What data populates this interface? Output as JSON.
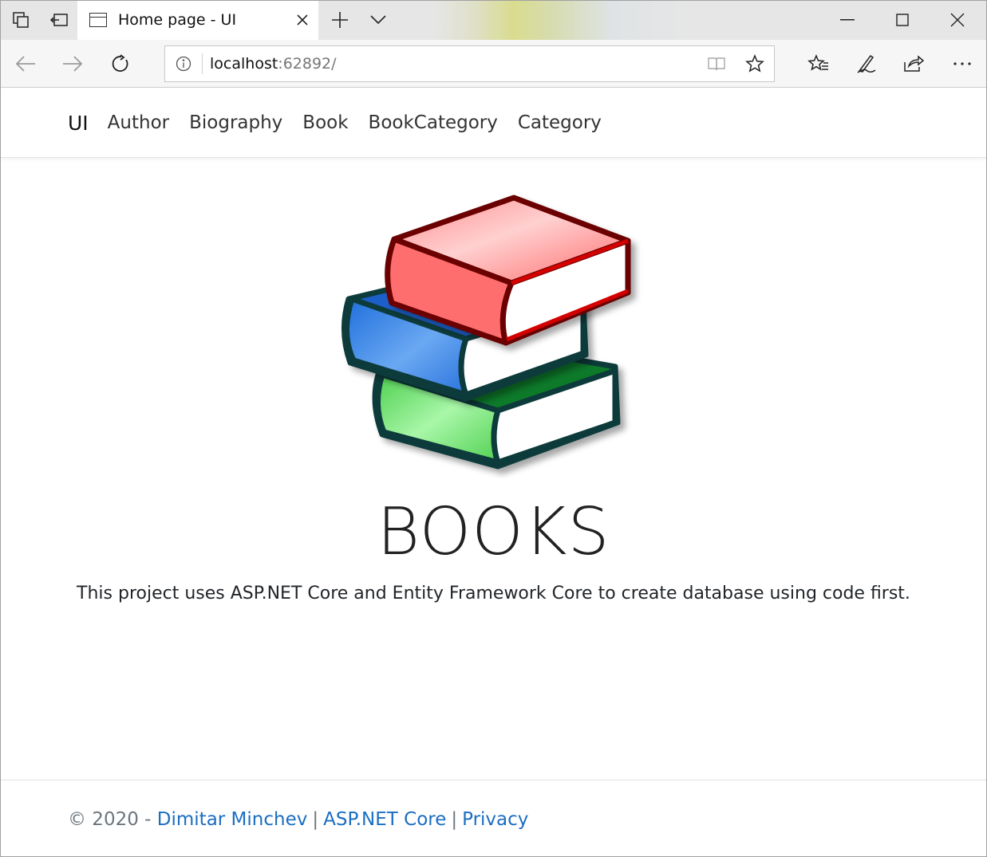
{
  "browser": {
    "tab_title": "Home page - UI",
    "address": {
      "host": "localhost",
      "port_path": ":62892/"
    }
  },
  "site": {
    "brand": "UI",
    "nav": [
      {
        "label": "Author"
      },
      {
        "label": "Biography"
      },
      {
        "label": "Book"
      },
      {
        "label": "BookCategory"
      },
      {
        "label": "Category"
      }
    ]
  },
  "main": {
    "title": "BOOKS",
    "description": "This project uses ASP.NET Core and Entity Framework Core to create database using code first."
  },
  "footer": {
    "copyright": "© 2020 -",
    "author_link": "Dimitar Minchev",
    "framework_link": "ASP.NET Core",
    "privacy_link": "Privacy",
    "separator": "|"
  },
  "colors": {
    "link": "#1b6ec2",
    "book_red": "#ff6e6e",
    "book_blue": "#2b78e4",
    "book_green": "#6ee06e"
  }
}
